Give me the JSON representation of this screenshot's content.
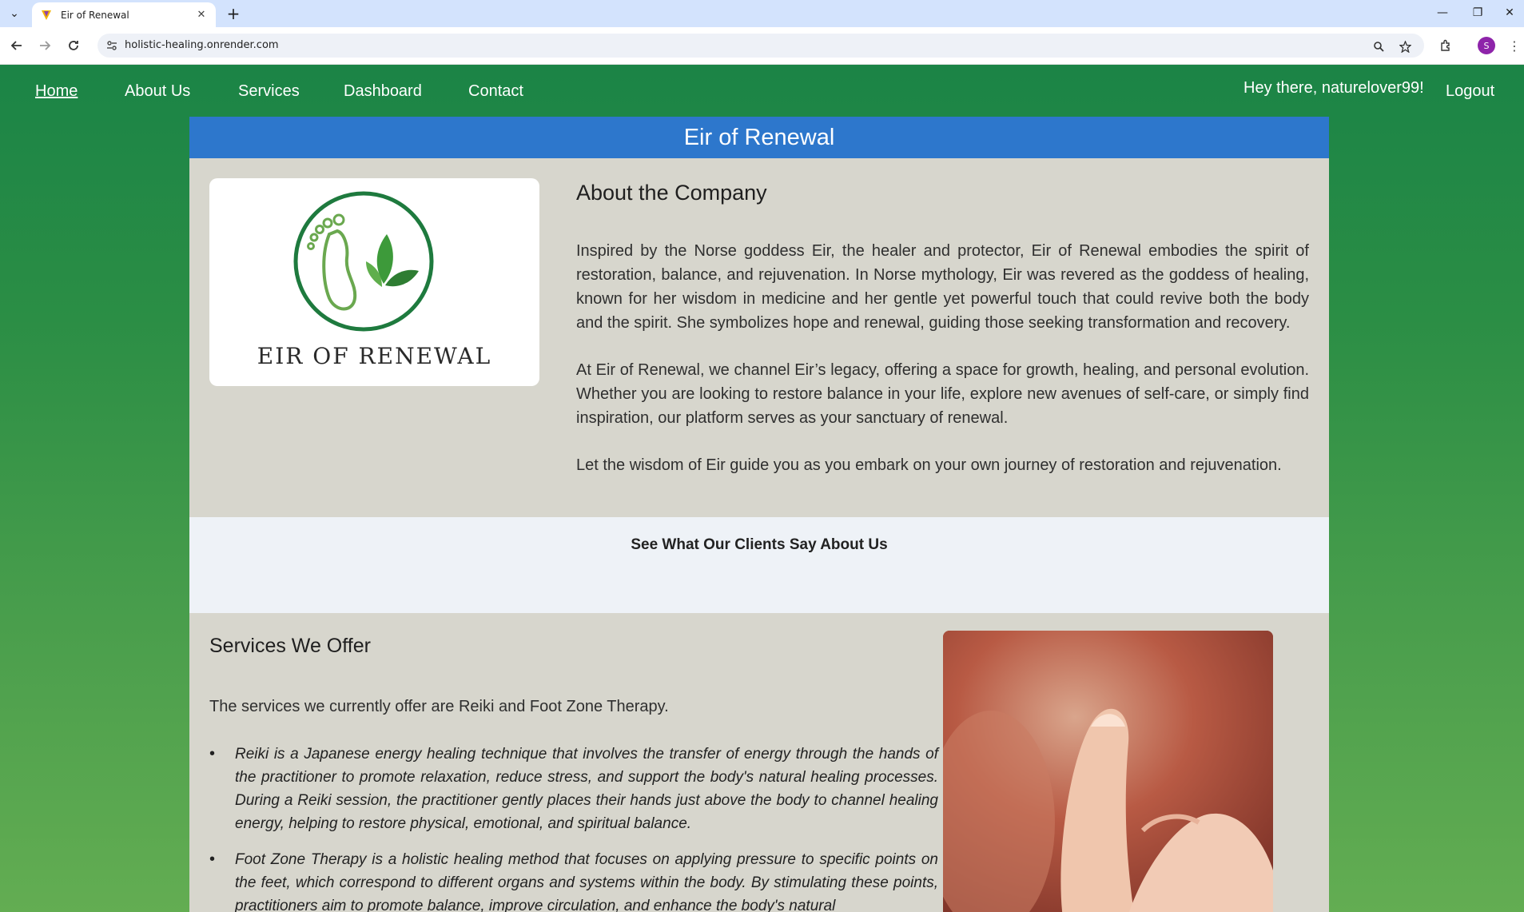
{
  "browser": {
    "tab_title": "Eir of Renewal",
    "url": "holistic-healing.onrender.com",
    "profile_initial": "S",
    "icons": [
      "tab-list-icon",
      "favicon-icon",
      "close-icon",
      "plus-icon",
      "minimize-icon",
      "restore-icon",
      "close-window-icon",
      "back-icon",
      "forward-icon",
      "reload-icon",
      "site-info-icon",
      "zoom-icon",
      "star-icon",
      "extensions-icon",
      "menu-icon"
    ]
  },
  "nav": {
    "home": "Home",
    "about": "About Us",
    "services": "Services",
    "dashboard": "Dashboard",
    "contact": "Contact",
    "greeting": "Hey there, naturelover99!",
    "logout": "Logout"
  },
  "banner": {
    "title": "Eir of Renewal"
  },
  "about": {
    "logo_text": "EIR OF RENEWAL",
    "title": "About the Company",
    "p1": "Inspired by the Norse goddess Eir, the healer and protector, Eir of Renewal embodies the spirit of restoration, balance, and rejuvenation. In Norse mythology, Eir was revered as the goddess of healing, known for her wisdom in medicine and her gentle yet powerful touch that could revive both the body and the spirit. She symbolizes hope and renewal, guiding those seeking transformation and recovery.",
    "p2": "At Eir of Renewal, we channel Eir’s legacy, offering a space for growth, healing, and personal evolution. Whether you are looking to restore balance in your life, explore new avenues of self-care, or simply find inspiration, our platform serves as your sanctuary of renewal.",
    "p3": "Let the wisdom of Eir guide you as you embark on your own journey of restoration and rejuvenation."
  },
  "testimonials": {
    "title": "See What Our Clients Say About Us"
  },
  "services": {
    "title": "Services We Offer",
    "intro": "The services we currently offer are Reiki and Foot Zone Therapy.",
    "items": [
      "Reiki is a Japanese energy healing technique that involves the transfer of energy through the hands of the practitioner to promote relaxation, reduce stress, and support the body's natural healing processes. During a Reiki session, the practitioner gently places their hands just above the body to channel healing energy, helping to restore physical, emotional, and spiritual balance.",
      "Foot Zone Therapy is a holistic healing method that focuses on applying pressure to specific points on the feet, which correspond to different organs and systems within the body. By stimulating these points, practitioners aim to promote balance, improve circulation, and enhance the body's natural"
    ]
  },
  "colors": {
    "nav_green": "#1b8446",
    "banner_blue": "#2d77cc",
    "section_beige": "#d7d6cd",
    "testimonials_bg": "#eef2f7"
  }
}
